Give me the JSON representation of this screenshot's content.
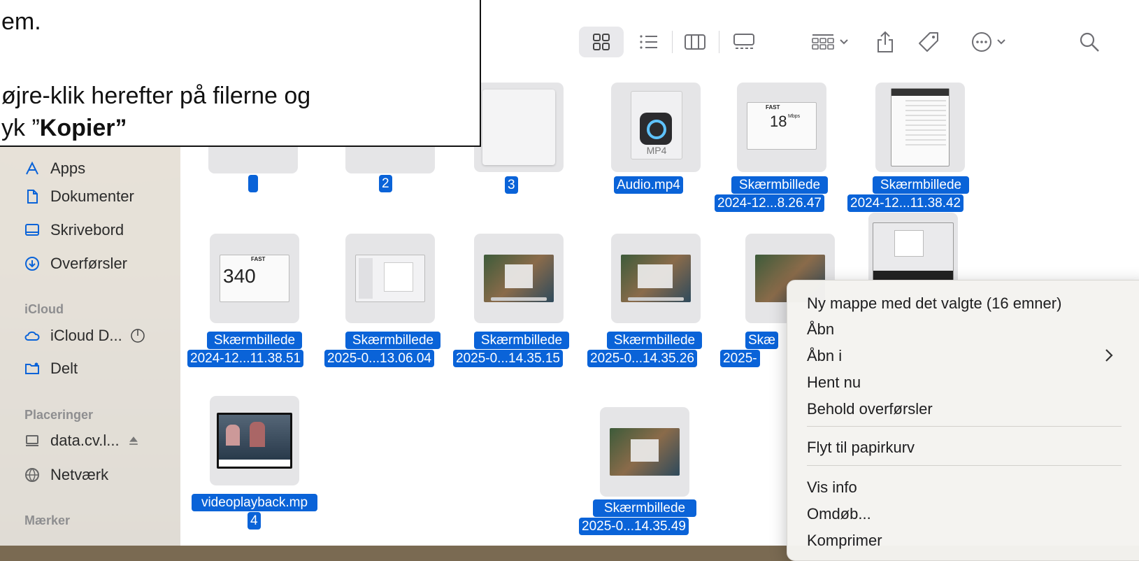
{
  "callout": {
    "line1": "em.",
    "line2": "øjre-klik herefter på filerne og",
    "line3_prefix": "yk ”",
    "line3_bold": "Kopier”"
  },
  "sidebar": {
    "items": [
      {
        "label": "Apps",
        "icon": "apps-icon"
      },
      {
        "label": "Dokumenter",
        "icon": "document-icon"
      },
      {
        "label": "Skrivebord",
        "icon": "desktop-icon"
      },
      {
        "label": "Overførsler",
        "icon": "download-icon"
      }
    ],
    "icloud_header": "iCloud",
    "icloud_items": [
      {
        "label": "iCloud D...",
        "icon": "cloud-icon"
      },
      {
        "label": "Delt",
        "icon": "shared-folder-icon"
      }
    ],
    "locations_header": "Placeringer",
    "location_items": [
      {
        "label": "data.cv.l...",
        "icon": "drive-icon"
      },
      {
        "label": "Netværk",
        "icon": "network-icon"
      }
    ],
    "tags_header": "Mærker"
  },
  "files": [
    {
      "line1": "",
      "line2": ""
    },
    {
      "line1": "2",
      "line2": ""
    },
    {
      "line1": "3",
      "line2": ""
    },
    {
      "line1": "Audio.mp4",
      "line2": "",
      "badge": "MP4"
    },
    {
      "line1": "Skærmbillede",
      "line2": "2024-12...8.26.47",
      "thumb_text": "FAST",
      "thumb_number": "18",
      "thumb_unit": "Mbps"
    },
    {
      "line1": "Skærmbillede",
      "line2": "2024-12...11.38.42"
    },
    {
      "line1": "Skærmbillede",
      "line2": "2024-12...11.38.51",
      "thumb_text": "FAST",
      "thumb_number": "340"
    },
    {
      "line1": "Skærmbillede",
      "line2": "2025-0...13.06.04"
    },
    {
      "line1": "Skærmbillede",
      "line2": "2025-0...14.35.15"
    },
    {
      "line1": "Skærmbillede",
      "line2": "2025-0...14.35.26"
    },
    {
      "line1": "Skæ",
      "line2": "2025-"
    },
    {
      "line1": "videoplayback.mp",
      "line2": "4"
    },
    {
      "line1": "Skærmbillede",
      "line2": "2025-0...14.35.49"
    }
  ],
  "context_menu": {
    "items": [
      "Ny mappe med det valgte (16 emner)",
      "Åbn",
      "Åbn i",
      "Hent nu",
      "Behold overførsler",
      "Flyt til papirkurv",
      "Vis info",
      "Omdøb...",
      "Komprimer"
    ]
  },
  "colors": {
    "selection": "#0a63d8",
    "sidebar_bg": "#ece8e2",
    "menu_bg": "#f4f3f0"
  }
}
